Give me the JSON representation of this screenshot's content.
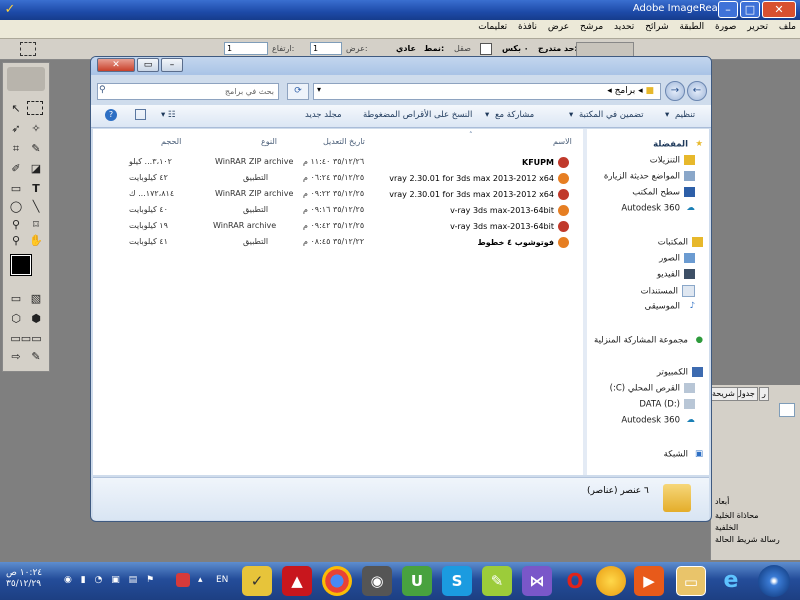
{
  "app": {
    "title": "Adobe ImageReady",
    "title_visible": "Adobe ImageReady",
    "menu": [
      "ملف",
      "تحرير",
      "صورة",
      "الطبقة",
      "شرائح",
      "تحديد",
      "مرشح",
      "عرض",
      "نافذة",
      "تعليمات"
    ]
  },
  "options_bar": {
    "style_label": "نمط:",
    "style_value": "عادي",
    "width_label": "عرض:",
    "width_value": "1",
    "height_label": "ارتفاع:",
    "height_value": "1",
    "feather_label": "حد متدرج:",
    "feather_value": "٠ بكس",
    "antialias_label": "صقل"
  },
  "explorer": {
    "search_placeholder": "بحث في برامج",
    "path": [
      "برامج"
    ],
    "toolbar": {
      "organize": "تنظيم",
      "include_library": "تضمين في المكتبة",
      "share": "مشاركة مع",
      "burn": "النسخ على الأقراص المضغوطة",
      "new_folder": "مجلد جديد"
    },
    "columns": {
      "name": "الاسم",
      "date": "تاريخ التعديل",
      "type": "النوع",
      "size": "الحجم"
    },
    "nav": {
      "favorites": "المفضلة",
      "favorites_items": [
        "التنزيلات",
        "المواضع حديثة الزيارة",
        "سطح المكتب",
        "Autodesk 360"
      ],
      "libraries": "المكتبات",
      "libraries_items": [
        "الصور",
        "الفيديو",
        "المستندات",
        "الموسيقى"
      ],
      "homegroup": "مجموعة المشاركة المنزلية",
      "computer": "الكمبيوتر",
      "computer_items": [
        "القرص المحلي (C:)",
        "DATA (D:)",
        "Autodesk 360"
      ],
      "network": "الشبكة"
    },
    "files": [
      {
        "name": "KFUPM",
        "date": "٣٥/١٢/٢٦ ١١:٤٠ م",
        "type": "WinRAR ZIP archive",
        "size": "٣،١٠٢... كيلو"
      },
      {
        "name": "vray 2.30.01 for 3ds max 2013-2012 x64",
        "date": "٣٥/١٢/٢٥ ٠٦:٢٤ م",
        "type": "التطبيق",
        "size": "٤٢ كيلوبايت"
      },
      {
        "name": "vray 2.30.01 for 3ds max 2013-2012 x64",
        "date": "٣٥/١٢/٢٥ ٠٩:٢٢ م",
        "type": "WinRAR ZIP archive",
        "size": "١٧٢،٨١٤... ك"
      },
      {
        "name": "v-ray 3ds max-2013-64bit",
        "date": "٣٥/١٢/٢٥ ٠٩:١٦ م",
        "type": "التطبيق",
        "size": "٤٠ كيلوبايت"
      },
      {
        "name": "v-ray 3ds max-2013-64bit",
        "date": "٣٥/١٢/٢٥ ٠٩:٤٢ م",
        "type": "WinRAR archive",
        "size": "١٩ كيلوبايت"
      },
      {
        "name": "فوتوشوب ٤ خطوط",
        "date": "٣٥/١٢/٢٢ ٠٨:٤٥ م",
        "type": "التطبيق",
        "size": "٤١ كيلوبايت"
      }
    ],
    "status": "٦ عنصر (عناصر)"
  },
  "panels": {
    "tabs": [
      "جدول",
      "شريحة",
      "ر"
    ],
    "items": [
      "أبعاد",
      "محاذاة الخلية",
      "الخلفية",
      "رسالة شريط الحالة"
    ]
  },
  "taskbar": {
    "clock_time": "١٠:٢٤ ص",
    "clock_date": "٣٥/١٢/٢٩",
    "lang": "EN"
  },
  "colors": {
    "titlebar": "#1d4aa8",
    "explorer_frame": "#cfdcec",
    "taskbar": "#244d9a"
  }
}
